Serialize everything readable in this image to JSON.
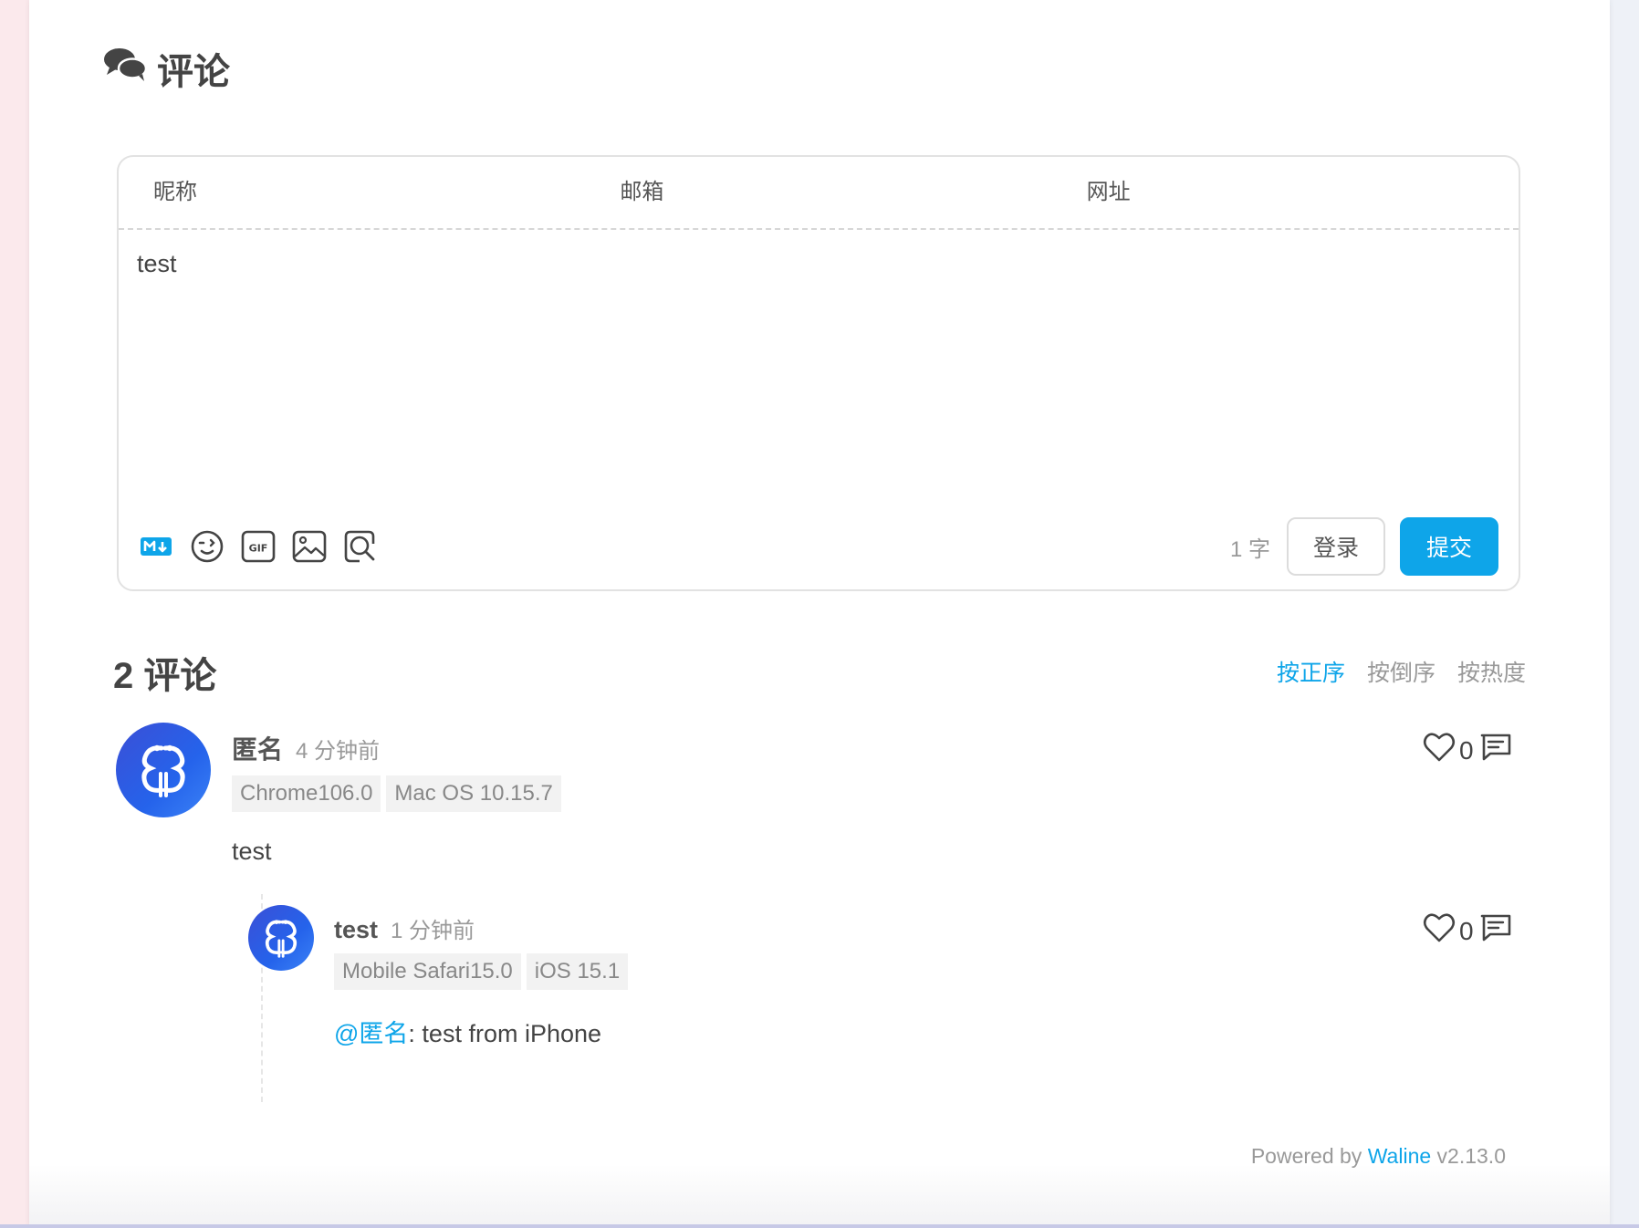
{
  "section": {
    "title": "评论"
  },
  "editor": {
    "nick_placeholder": "昵称",
    "mail_placeholder": "邮箱",
    "link_placeholder": "网址",
    "content": "test",
    "word_count": "1 字",
    "login_label": "登录",
    "submit_label": "提交"
  },
  "list": {
    "count_title": "2 评论",
    "sort": [
      "按正序",
      "按倒序",
      "按热度"
    ],
    "active_sort": "按正序"
  },
  "comments": [
    {
      "nick": "匿名",
      "time": "4 分钟前",
      "tags": [
        "Chrome106.0",
        "Mac OS 10.15.7"
      ],
      "likes": "0",
      "body": "test"
    },
    {
      "nick": "test",
      "time": "1 分钟前",
      "tags": [
        "Mobile Safari15.0",
        "iOS 15.1"
      ],
      "likes": "0",
      "mention": "@匿名",
      "body": ": test from iPhone"
    }
  ],
  "footer": {
    "powered_prefix": "Powered by",
    "powered_link": "Waline",
    "version": "v2.13.0"
  },
  "colors": {
    "accent": "#0ea5e9",
    "text": "#444444",
    "muted": "#999999"
  },
  "icons": [
    "comments-icon",
    "markdown-icon",
    "emoji-icon",
    "gif-icon",
    "image-icon",
    "preview-icon",
    "heart-icon",
    "reply-icon"
  ]
}
